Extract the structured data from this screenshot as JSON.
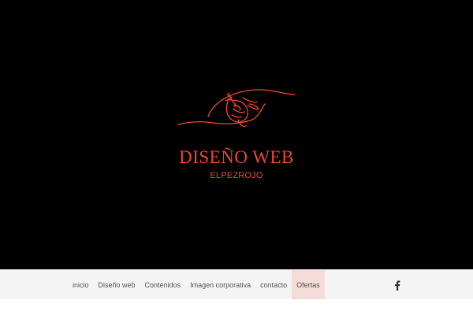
{
  "brand": {
    "title": "DISEÑO WEB",
    "subtitle": "ELPEZROJO",
    "accent_color": "#e8402a"
  },
  "nav": {
    "items": [
      {
        "label": "inicio"
      },
      {
        "label": "Diseño web"
      },
      {
        "label": "Contenidos"
      },
      {
        "label": "Imagen corporativa"
      },
      {
        "label": "contacto"
      },
      {
        "label": "Ofertas",
        "active": true
      }
    ],
    "active_bg": "#f4dcd8",
    "social_icon": "facebook-icon"
  }
}
